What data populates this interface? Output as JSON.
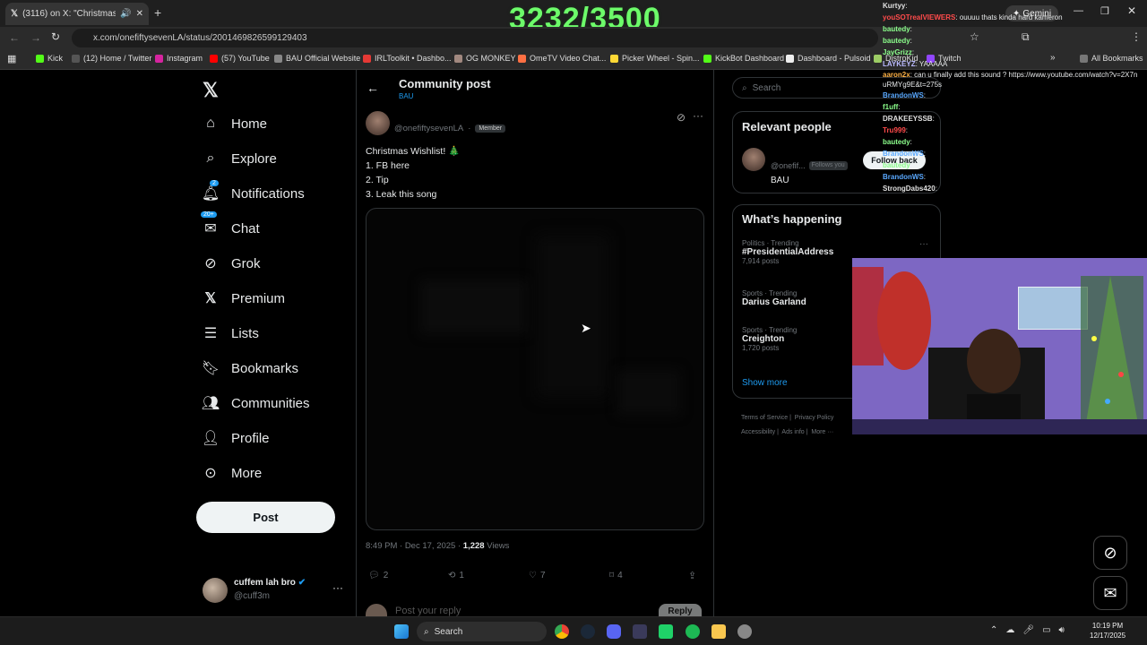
{
  "browser": {
    "tab_title": "(3116) on X: \"Christmas W",
    "url": "x.com/onefiftysevenLA/status/2001469826599129403",
    "bookmarks": [
      "Kick",
      "(12) Home / Twitter",
      "Instagram",
      "(57) YouTube",
      "BAU Official Website",
      "IRLToolkit • Dashbo...",
      "OG MONKEY",
      "OmeTV Video Chat...",
      "Picker Wheel - Spin...",
      "KickBot Dashboard",
      "Dashboard - Pulsoid",
      "DistroKid",
      "Twitch"
    ],
    "all_bookmarks": "All Bookmarks",
    "gemini": "Gemini"
  },
  "overlay": {
    "counter": "3232/3500"
  },
  "nav": {
    "items": [
      "Home",
      "Explore",
      "Notifications",
      "Chat",
      "Grok",
      "Premium",
      "Lists",
      "Bookmarks",
      "Communities",
      "Profile",
      "More"
    ],
    "notif_badge": "2",
    "chat_badge": "20+",
    "post_label": "Post",
    "account_name": "cuffem lah bro",
    "account_handle": "@cuff3m"
  },
  "post": {
    "header_title": "Community post",
    "community": "BAU",
    "handle": "@onefiftysevenLA",
    "member_badge": "Member",
    "text_lines": [
      "Christmas Wishlist! 🎄",
      "1. FB here",
      "2. Tip",
      "3. Leak this song"
    ],
    "timestamp": "8:49 PM · Dec 17, 2025 ·",
    "views_count": "1,228",
    "views_label": "Views",
    "replies": "2",
    "reposts": "1",
    "likes": "7",
    "bookmarks": "4",
    "reply_placeholder": "Post your reply",
    "reply_button": "Reply"
  },
  "right": {
    "search_placeholder": "Search",
    "relevant_title": "Relevant people",
    "person_handle": "@onefif...",
    "follows_you": "Follows you",
    "person_name": "BAU",
    "follow_back": "Follow back",
    "happening_title": "What’s happening",
    "trends": [
      {
        "cat": "Politics · Trending",
        "name": "#PresidentialAddress",
        "count": "7,914 posts"
      },
      {
        "cat": "Sports · Trending",
        "name": "Darius Garland",
        "count": ""
      },
      {
        "cat": "Sports · Trending",
        "name": "Creighton",
        "count": "1,720 posts"
      }
    ],
    "show_more": "Show more",
    "footer": [
      "Terms of Service",
      "Privacy Policy",
      "Accessibility",
      "Ads info",
      "More ···"
    ]
  },
  "chat": [
    {
      "user": "Kurtyy",
      "msg": "",
      "color": "#e0e0e0"
    },
    {
      "user": "youSOTrealVIEWERS",
      "msg": "ouuuu thats kinda hard kameron",
      "color": "#ff4b4b"
    },
    {
      "user": "bautedy",
      "msg": "",
      "color": "#8cff8c"
    },
    {
      "user": "bautedy",
      "msg": "",
      "color": "#8cff8c"
    },
    {
      "user": "JayGrizz",
      "msg": "",
      "color": "#8cff8c"
    },
    {
      "user": "LAYKEYZ",
      "msg": "YAAAAA",
      "color": "#bbbbff"
    },
    {
      "user": "aaron2x",
      "msg": "can u finally add this sound ? https://www.youtube.com/watch?v=2X7nuRMYg9E&t=275s",
      "color": "#ffb347"
    },
    {
      "user": "BrandonWS",
      "msg": "",
      "color": "#5aa9ff"
    },
    {
      "user": "f1uff",
      "msg": "",
      "color": "#8cff8c"
    },
    {
      "user": "DRAKEEYSSB",
      "msg": "",
      "color": "#e0e0e0"
    },
    {
      "user": "Tru999",
      "msg": "",
      "color": "#ff4b4b"
    },
    {
      "user": "bautedy",
      "msg": "",
      "color": "#8cff8c"
    },
    {
      "user": "BrandonWS",
      "msg": "",
      "color": "#5aa9ff"
    },
    {
      "user": "bautedy",
      "msg": "",
      "color": "#8cff8c"
    },
    {
      "user": "BrandonWS",
      "msg": "",
      "color": "#5aa9ff"
    },
    {
      "user": "StrongDabs420",
      "msg": "",
      "color": "#e0e0e0"
    }
  ],
  "taskbar": {
    "search": "Search",
    "time": "10:19 PM",
    "date": "12/17/2025"
  },
  "colors": {
    "accent": "#1d9bf0",
    "overlay_green": "#6dfb6a"
  }
}
